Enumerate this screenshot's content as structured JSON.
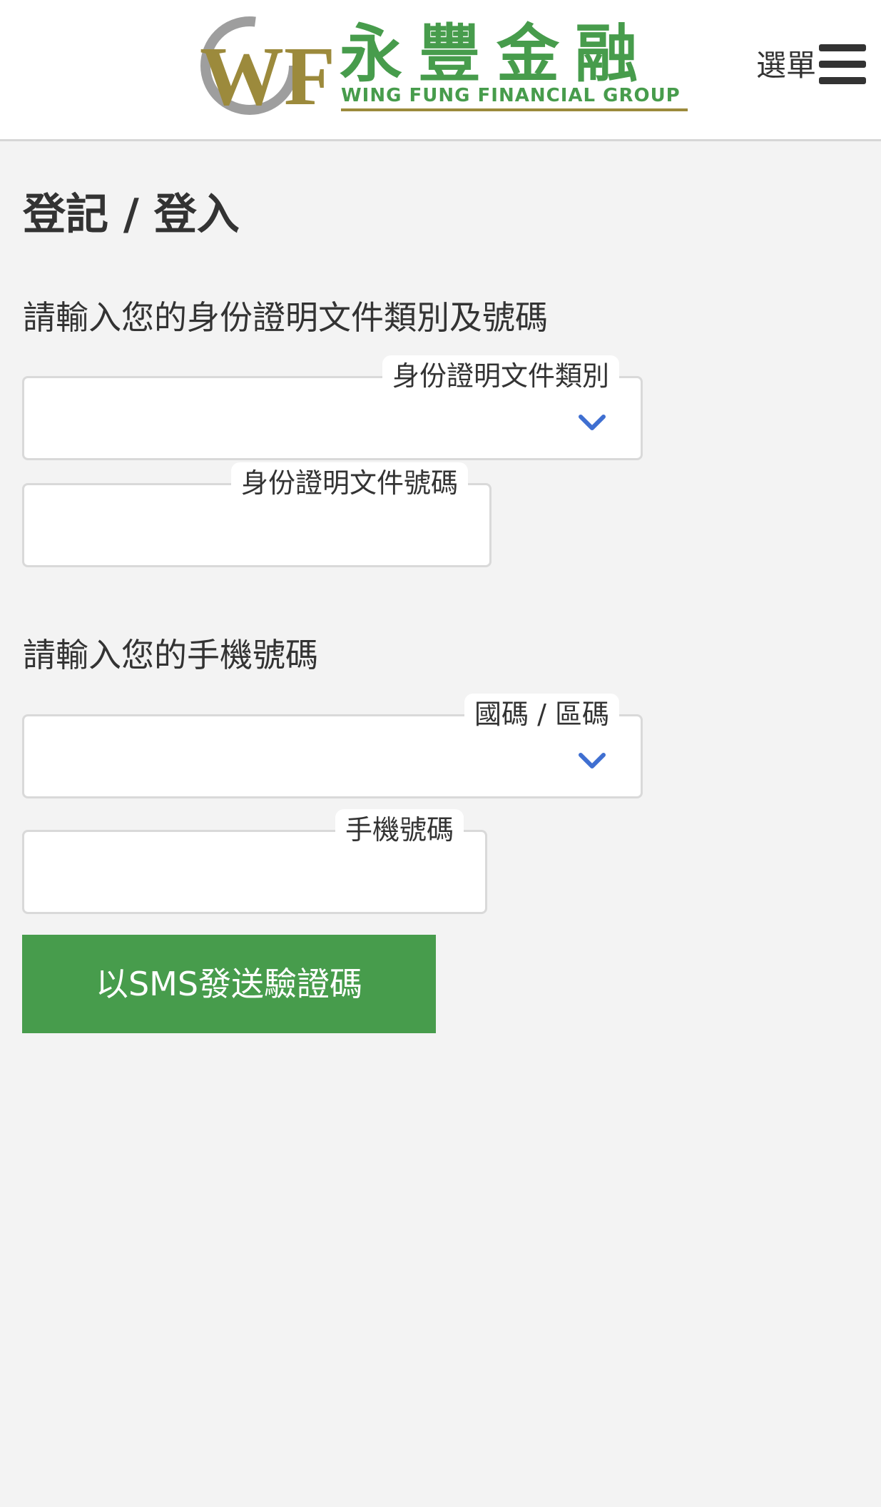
{
  "header": {
    "logo_chinese": "永豐金融",
    "logo_english": "WING FUNG FINANCIAL GROUP",
    "logo_monogram": "WF",
    "menu_label": "選單",
    "menu_icon": "hamburger-icon"
  },
  "page": {
    "title": "登記 / 登入"
  },
  "id_section": {
    "label": "請輸入您的身份證明文件類別及號碼",
    "doc_type": {
      "label": "身份證明文件類別",
      "value": "",
      "icon": "chevron-down-icon"
    },
    "doc_number": {
      "label": "身份證明文件號碼",
      "value": ""
    }
  },
  "phone_section": {
    "label": "請輸入您的手機號碼",
    "country_code": {
      "label": "國碼 / 區碼",
      "value": "",
      "icon": "chevron-down-icon"
    },
    "phone_number": {
      "label": "手機號碼",
      "value": ""
    }
  },
  "actions": {
    "send_sms_label": "以SMS發送驗證碼"
  },
  "colors": {
    "brand_green": "#479c4c",
    "logo_gold": "#9c8a3c",
    "chevron_blue": "#3f6fd1",
    "background": "#f3f3f3"
  }
}
